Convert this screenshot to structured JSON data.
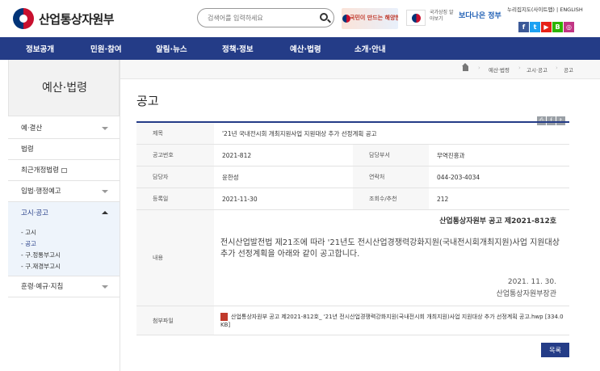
{
  "header": {
    "logo_text": "산업통상자원부",
    "search_placeholder": "검색어를 입력하세요",
    "banner1_text": "국민이 만드는 해양한국",
    "patriot_text": "국가상징 알아보기",
    "better_gov": "보다나은 정부",
    "top_links": "누리집지도(사이트맵)  |  ENGLISH",
    "social": [
      "f",
      "t",
      "▶",
      "B",
      "◎"
    ]
  },
  "nav": [
    "정보공개",
    "민원·참여",
    "알림·뉴스",
    "정책·정보",
    "예산·법령",
    "소개·안내"
  ],
  "sidebar": {
    "title": "예산·법령",
    "items": [
      "예·결산",
      "법령",
      "최근개정법령",
      "입법·행정예고",
      "고시·공고",
      "훈령·예규·지침"
    ],
    "sub_items": [
      "- 고시",
      "- 공고",
      "- 구.정통부고시",
      "- 구.재경부고시"
    ]
  },
  "breadcrumb": [
    "예산·법령",
    "고시·공고",
    "공고"
  ],
  "page_title": "공고",
  "tools": [
    "⎙",
    "f",
    "t"
  ],
  "board": {
    "subject_label": "제목",
    "subject": "'21년 국내전시회 개최지원사업 지원대상 추가 선정계획 공고",
    "number_label": "공고번호",
    "number": "2021-812",
    "dept_label": "담당부서",
    "dept": "무역진흥과",
    "manager_label": "담당자",
    "manager": "윤한성",
    "contact_label": "연락처",
    "contact": "044-203-4034",
    "date_label": "등록일",
    "date": "2021-11-30",
    "views_label": "조회수/추천",
    "views": "212",
    "content_label": "내용",
    "content_org": "산업통상자원부 공고 제2021-812호",
    "content_text": "전시산업발전법 제21조에 따라 '21년도 전시산업경쟁력강화지원(국내전시회개최지원)사업 지원대상 추가 선정계획을 아래와 같이 공고합니다.",
    "content_date": "2021. 11. 30.",
    "content_sign": "산업통상자원부장관",
    "file_label": "첨부파일",
    "file_name": "산업통상자원부 공고 제2021-812호_ '21년 전시산업경쟁력강화지원(국내전시회 개최지원)사업 지원대상 추가 선정계획 공고.hwp [334.0 KB]"
  },
  "list_button": "목록"
}
